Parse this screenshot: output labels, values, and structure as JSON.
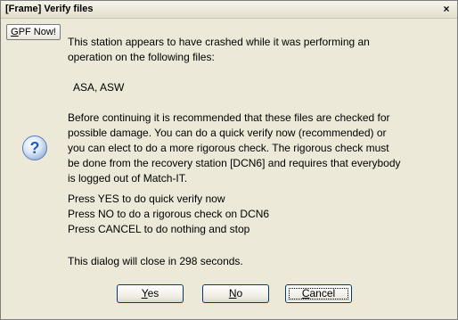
{
  "window": {
    "title": "[Frame] Verify files",
    "close_glyph": "×"
  },
  "gpf_button": {
    "label_mnemonic": "G",
    "label_rest": "PF Now!"
  },
  "icon": {
    "name": "question-icon",
    "glyph": "?",
    "color": "#1f5fbf"
  },
  "message": {
    "line1": "This station appears to have crashed while it was performing an",
    "line2": "operation on the following files:",
    "files": "ASA, ASW",
    "para2_line1": "Before continuing it is recommended that these files are checked for",
    "para2_line2": "possible damage. You can do a quick verify now (recommended) or",
    "para2_line3": "you can elect to do a more rigorous check. The rigorous check must",
    "para2_line4": "be done from the recovery station [DCN6] and requires that everybody",
    "para2_line5": "is logged out of Match-IT.",
    "press_yes": "Press YES to do quick verify now",
    "press_no": "Press NO to do a rigorous check on DCN6",
    "press_cancel": "Press CANCEL to do nothing and stop",
    "countdown": "This dialog will close in 298 seconds."
  },
  "buttons": {
    "yes": {
      "mnemonic": "Y",
      "rest": "es"
    },
    "no": {
      "mnemonic": "N",
      "rest": "o"
    },
    "cancel": {
      "mnemonic": "C",
      "rest": "ancel"
    }
  }
}
